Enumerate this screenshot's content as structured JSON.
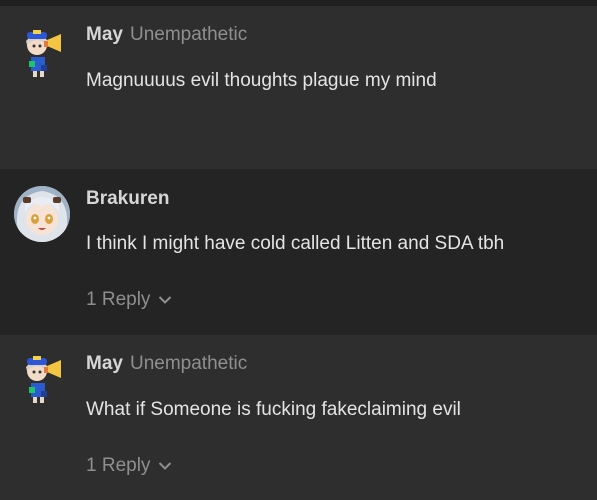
{
  "posts": [
    {
      "username": "May",
      "user_title": "Unempathetic",
      "body": "Magnuuuus evil thoughts plague my mind",
      "avatar": "chibi-megaphone-avatar"
    },
    {
      "username": "Brakuren",
      "user_title": "",
      "body": "I think I might have cold called Litten and SDA tbh",
      "avatar": "anime-girl-avatar",
      "replies_label": "1 Reply",
      "replies_icon": "chevron-down-icon"
    },
    {
      "username": "May",
      "user_title": "Unempathetic",
      "body": "What if Someone is fucking fakeclaiming evil",
      "avatar": "chibi-megaphone-avatar",
      "replies_label": "1 Reply",
      "replies_icon": "chevron-down-icon"
    }
  ],
  "colors": {
    "page_bg": "#2e2e2e",
    "highlight_post_bg": "#242424",
    "username": "#d6d6d6",
    "muted": "#8f8f8f",
    "body_text": "#e4e4e4"
  }
}
